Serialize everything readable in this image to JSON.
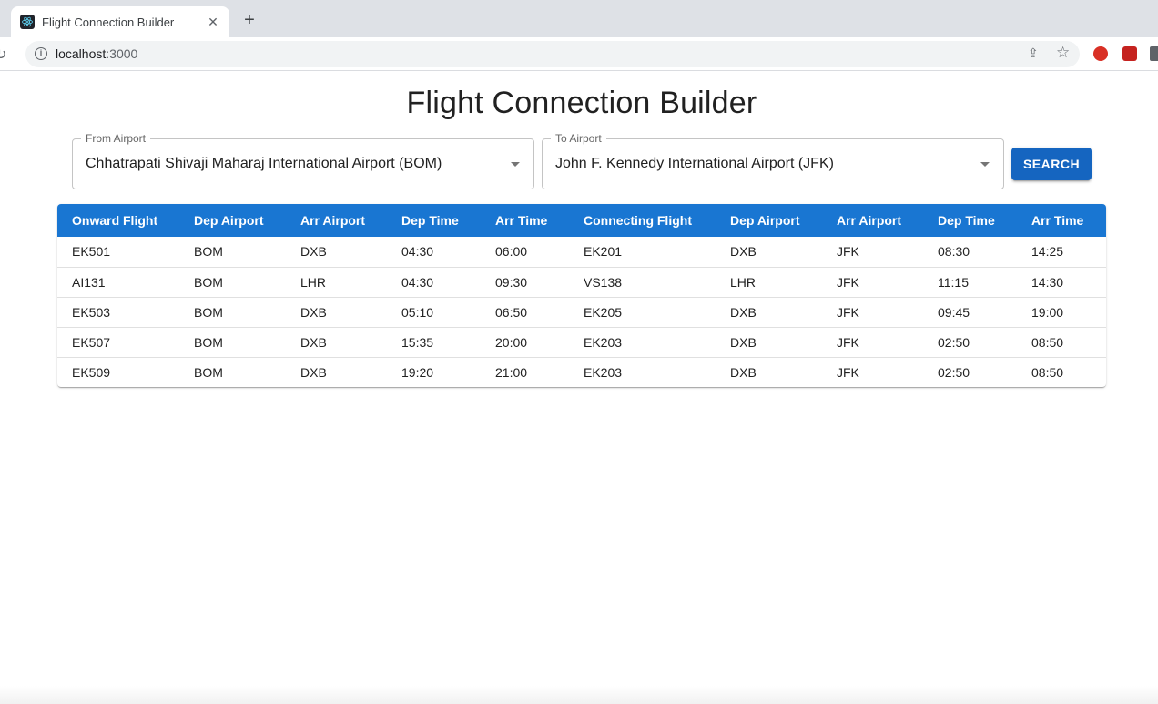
{
  "browser": {
    "tab_title": "Flight Connection Builder",
    "tab_close": "✕",
    "new_tab": "+",
    "url_host": "localhost",
    "url_port": ":3000"
  },
  "page": {
    "title": "Flight Connection Builder"
  },
  "form": {
    "from_label": "From Airport",
    "from_value": "Chhatrapati Shivaji Maharaj International Airport (BOM)",
    "to_label": "To Airport",
    "to_value": "John F. Kennedy International Airport (JFK)",
    "search_label": "SEARCH"
  },
  "table": {
    "headers": [
      "Onward Flight",
      "Dep Airport",
      "Arr Airport",
      "Dep Time",
      "Arr Time",
      "Connecting Flight",
      "Dep Airport",
      "Arr Airport",
      "Dep Time",
      "Arr Time"
    ],
    "rows": [
      [
        "EK501",
        "BOM",
        "DXB",
        "04:30",
        "06:00",
        "EK201",
        "DXB",
        "JFK",
        "08:30",
        "14:25"
      ],
      [
        "AI131",
        "BOM",
        "LHR",
        "04:30",
        "09:30",
        "VS138",
        "LHR",
        "JFK",
        "11:15",
        "14:30"
      ],
      [
        "EK503",
        "BOM",
        "DXB",
        "05:10",
        "06:50",
        "EK205",
        "DXB",
        "JFK",
        "09:45",
        "19:00"
      ],
      [
        "EK507",
        "BOM",
        "DXB",
        "15:35",
        "20:00",
        "EK203",
        "DXB",
        "JFK",
        "02:50",
        "08:50"
      ],
      [
        "EK509",
        "BOM",
        "DXB",
        "19:20",
        "21:00",
        "EK203",
        "DXB",
        "JFK",
        "02:50",
        "08:50"
      ]
    ]
  },
  "colors": {
    "header_bg": "#1976d2",
    "button_bg": "#1565c0"
  }
}
